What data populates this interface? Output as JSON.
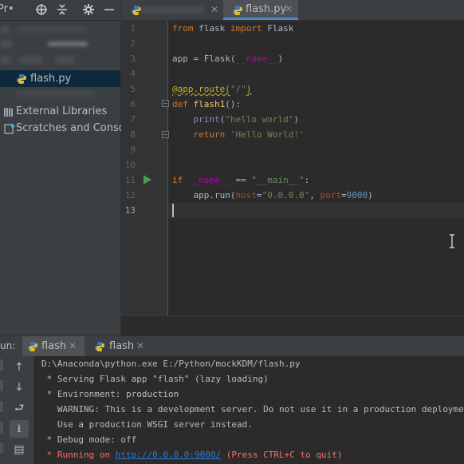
{
  "project_panel": {
    "title": "Pr•",
    "tree": [
      {
        "label": "flash.py",
        "selected": true
      },
      {
        "label": "External Libraries"
      },
      {
        "label": "Scratches and Console"
      }
    ]
  },
  "editor": {
    "tabs": [
      {
        "label": "",
        "blurred": true
      },
      {
        "label": "flash.py",
        "active": true
      }
    ],
    "line_numbers": [
      "1",
      "2",
      "3",
      "4",
      "5",
      "6",
      "7",
      "8",
      "9",
      "10",
      "11",
      "12",
      "13"
    ]
  },
  "run": {
    "label": "un:",
    "tabs": [
      "flash",
      "flash"
    ]
  },
  "console": {
    "lines": [
      "D:\\Anaconda\\python.exe E:/Python/mockKDM/flash.py",
      " * Serving Flask app \"flash\" (lazy loading)",
      " * Environment: production",
      "   WARNING: This is a development server. Do not use it in a production deployment.",
      "   Use a production WSGI server instead.",
      " * Debug mode: off"
    ],
    "running_prefix": " * Running on ",
    "running_url": "http://0.0.0.0:9000/",
    "running_suffix": " (Press CTRL+C to quit)"
  },
  "colors": {
    "background": "#2b2b2b",
    "panel": "#3c3f41",
    "keyword": "#cc7832",
    "string": "#6a8759",
    "selection": "#0d293e",
    "accent": "#4a88c7",
    "error": "#ff6b68",
    "link": "#287bde"
  }
}
